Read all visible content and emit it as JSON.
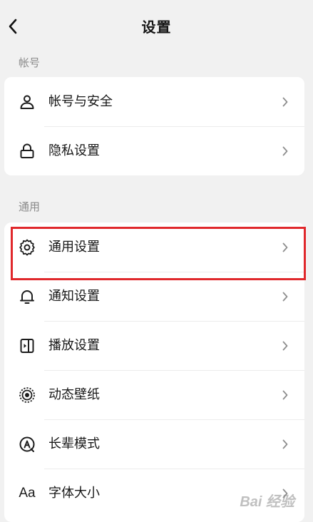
{
  "header": {
    "title": "设置"
  },
  "sections": [
    {
      "label": "帐号",
      "items": [
        {
          "label": "帐号与安全",
          "icon": "user-icon"
        },
        {
          "label": "隐私设置",
          "icon": "lock-icon"
        }
      ]
    },
    {
      "label": "通用",
      "items": [
        {
          "label": "通用设置",
          "icon": "gear-icon"
        },
        {
          "label": "通知设置",
          "icon": "bell-icon"
        },
        {
          "label": "播放设置",
          "icon": "playback-icon"
        },
        {
          "label": "动态壁纸",
          "icon": "live-wallpaper-icon"
        },
        {
          "label": "长辈模式",
          "icon": "elder-mode-icon"
        },
        {
          "label": "字体大小",
          "icon": "font-size-icon",
          "icon_text": "Aa"
        }
      ]
    }
  ],
  "colors": {
    "background": "#f1f1f1",
    "card": "#ffffff",
    "highlight": "#e0282c"
  }
}
